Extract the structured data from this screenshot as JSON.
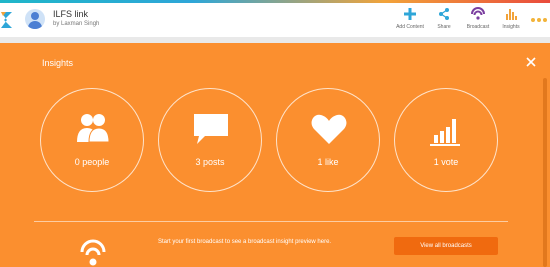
{
  "colors": {
    "panel": "#fb8f2f",
    "accent_button": "#f06a0f",
    "header_bg": "#ffffff",
    "stripe": [
      "#1fb6c9",
      "#2ea6d8",
      "#f2a33a",
      "#e94b3c"
    ]
  },
  "header": {
    "title": "ILFS link",
    "subtitle": "by Laxman Singh",
    "actions": [
      {
        "label": "Add Content",
        "icon": "plus-icon",
        "color": "#2ea6d8"
      },
      {
        "label": "Share",
        "icon": "share-icon",
        "color": "#2ea6d8"
      },
      {
        "label": "Broadcast",
        "icon": "broadcast-icon",
        "color": "#7b3fa0"
      },
      {
        "label": "Insights",
        "icon": "bar-chart-icon",
        "color": "#f2a33a"
      }
    ]
  },
  "insights": {
    "title": "Insights",
    "stats": [
      {
        "label": "0 people",
        "icon": "people-icon"
      },
      {
        "label": "3 posts",
        "icon": "chat-bubble-icon"
      },
      {
        "label": "1 like",
        "icon": "heart-icon"
      },
      {
        "label": "1 vote",
        "icon": "bar-chart-icon"
      }
    ],
    "promo_text": "Start your first broadcast to see a broadcast insight preview here.",
    "view_all_label": "View all broadcasts"
  }
}
